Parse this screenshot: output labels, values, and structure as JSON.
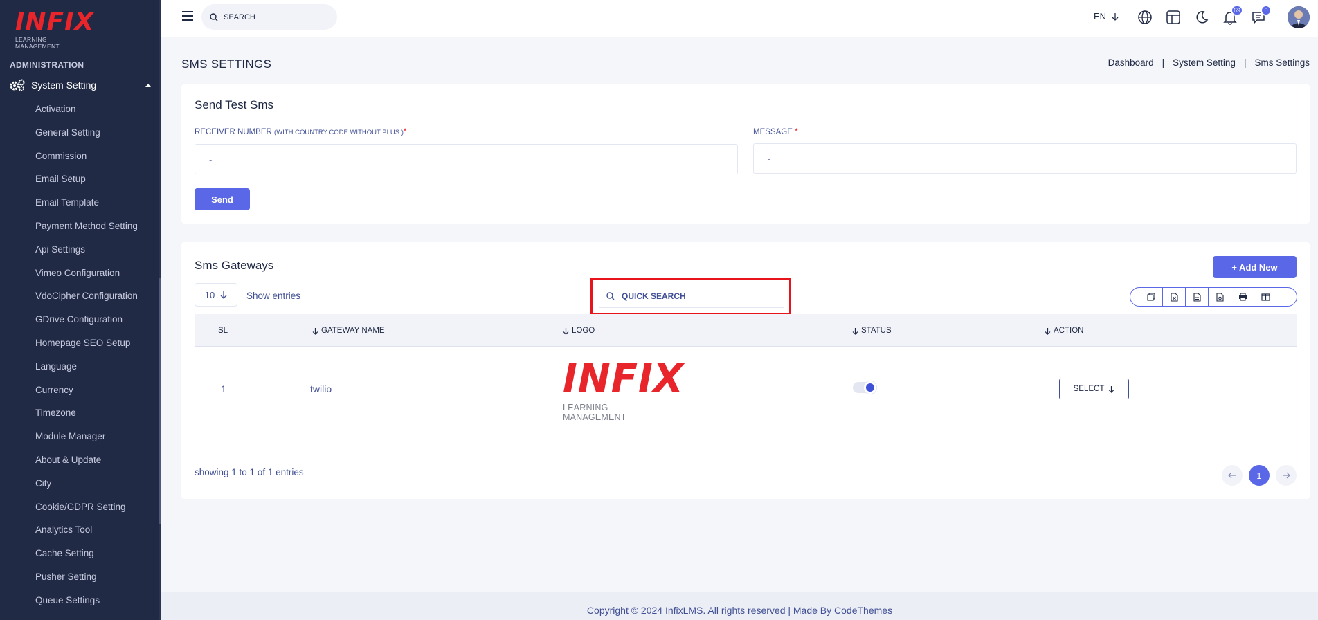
{
  "sidebar": {
    "logo_main": "INFIX",
    "logo_sub": "LEARNING MANAGEMENT",
    "section_label": "ADMINISTRATION",
    "group_label": "System Setting",
    "items": [
      {
        "label": "Activation"
      },
      {
        "label": "General Setting"
      },
      {
        "label": "Commission"
      },
      {
        "label": "Email Setup"
      },
      {
        "label": "Email Template"
      },
      {
        "label": "Payment Method Setting"
      },
      {
        "label": "Api Settings"
      },
      {
        "label": "Vimeo Configuration"
      },
      {
        "label": "VdoCipher Configuration"
      },
      {
        "label": "GDrive Configuration"
      },
      {
        "label": "Homepage SEO Setup"
      },
      {
        "label": "Language"
      },
      {
        "label": "Currency"
      },
      {
        "label": "Timezone"
      },
      {
        "label": "Module Manager"
      },
      {
        "label": "About & Update"
      },
      {
        "label": "City"
      },
      {
        "label": "Cookie/GDPR Setting"
      },
      {
        "label": "Analytics Tool"
      },
      {
        "label": "Cache Setting"
      },
      {
        "label": "Pusher Setting"
      },
      {
        "label": "Queue Settings"
      }
    ]
  },
  "header": {
    "search_placeholder": "SEARCH",
    "language": "EN",
    "notifications_count": "69",
    "messages_count": "0"
  },
  "page": {
    "title": "SMS SETTINGS",
    "breadcrumb": [
      "Dashboard",
      "System Setting",
      "Sms Settings"
    ]
  },
  "test_sms": {
    "title": "Send Test Sms",
    "receiver_label": "RECEIVER NUMBER",
    "receiver_note": "(WITH COUNTRY CODE WITHOUT PLUS )",
    "receiver_value": "-",
    "message_label": "MESSAGE",
    "message_value": "-",
    "required_mark": "*",
    "send_label": "Send"
  },
  "gateways": {
    "title": "Sms Gateways",
    "add_new_label": "+ Add New",
    "entries_value": "10",
    "show_entries_label": "Show entries",
    "quick_search_placeholder": "QUICK SEARCH",
    "columns": [
      "SL",
      "GATEWAY NAME",
      "LOGO",
      "STATUS",
      "ACTION"
    ],
    "rows": [
      {
        "sl": "1",
        "name": "twilio",
        "logo_main": "INFIX",
        "logo_sub": "LEARNING MANAGEMENT",
        "status_on": true,
        "action_label": "SELECT"
      }
    ],
    "showing_text": "showing 1 to 1 of 1 entries",
    "current_page": "1"
  },
  "footer": {
    "text": "Copyright © 2024 InfixLMS. All rights reserved | Made By CodeThemes"
  },
  "colors": {
    "sidebar_bg": "#202a44",
    "accent": "#5a67e6",
    "brand_red": "#e8252b",
    "highlight_box": "#e8141b"
  }
}
